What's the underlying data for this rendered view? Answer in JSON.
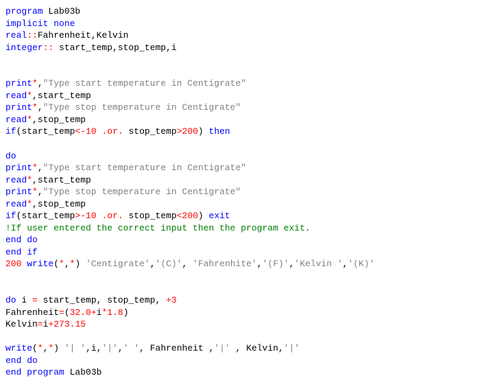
{
  "lines": [
    [
      [
        "kw",
        "program"
      ],
      [
        "txt",
        " Lab03b"
      ]
    ],
    [
      [
        "kw",
        "implicit none"
      ]
    ],
    [
      [
        "kw",
        "real"
      ],
      [
        "op",
        "::"
      ],
      [
        "txt",
        "Fahrenheit,Kelvin"
      ]
    ],
    [
      [
        "kw",
        "integer"
      ],
      [
        "op",
        ":: "
      ],
      [
        "txt",
        "start_temp,stop_temp,i"
      ]
    ],
    [],
    [],
    [
      [
        "kw",
        "print"
      ],
      [
        "op",
        "*"
      ],
      [
        "txt",
        ","
      ],
      [
        "str",
        "\"Type start temperature in Centigrate\""
      ]
    ],
    [
      [
        "kw",
        "read"
      ],
      [
        "op",
        "*"
      ],
      [
        "txt",
        ",start_temp"
      ]
    ],
    [
      [
        "kw",
        "print"
      ],
      [
        "op",
        "*"
      ],
      [
        "txt",
        ","
      ],
      [
        "str",
        "\"Type stop temperature in Centigrate\""
      ]
    ],
    [
      [
        "kw",
        "read"
      ],
      [
        "op",
        "*"
      ],
      [
        "txt",
        ",stop_temp"
      ]
    ],
    [
      [
        "kw",
        "if"
      ],
      [
        "txt",
        "(start_temp"
      ],
      [
        "op",
        "<-"
      ],
      [
        "num",
        "10"
      ],
      [
        "txt",
        " "
      ],
      [
        "op",
        ".or."
      ],
      [
        "txt",
        " stop_temp"
      ],
      [
        "op",
        ">"
      ],
      [
        "num",
        "200"
      ],
      [
        "txt",
        ") "
      ],
      [
        "kw",
        "then"
      ]
    ],
    [],
    [
      [
        "kw",
        "do"
      ]
    ],
    [
      [
        "kw",
        "print"
      ],
      [
        "op",
        "*"
      ],
      [
        "txt",
        ","
      ],
      [
        "str",
        "\"Type start temperature in Centigrate\""
      ]
    ],
    [
      [
        "kw",
        "read"
      ],
      [
        "op",
        "*"
      ],
      [
        "txt",
        ",start_temp"
      ]
    ],
    [
      [
        "kw",
        "print"
      ],
      [
        "op",
        "*"
      ],
      [
        "txt",
        ","
      ],
      [
        "str",
        "\"Type stop temperature in Centigrate\""
      ]
    ],
    [
      [
        "kw",
        "read"
      ],
      [
        "op",
        "*"
      ],
      [
        "txt",
        ",stop_temp"
      ]
    ],
    [
      [
        "kw",
        "if"
      ],
      [
        "txt",
        "(start_temp"
      ],
      [
        "op",
        ">-"
      ],
      [
        "num",
        "10"
      ],
      [
        "txt",
        " "
      ],
      [
        "op",
        ".or."
      ],
      [
        "txt",
        " stop_temp"
      ],
      [
        "op",
        "<"
      ],
      [
        "num",
        "200"
      ],
      [
        "txt",
        ") "
      ],
      [
        "kw",
        "exit"
      ]
    ],
    [
      [
        "cm",
        "!If user entered the correct input then the program exit."
      ]
    ],
    [
      [
        "kw",
        "end do"
      ]
    ],
    [
      [
        "kw",
        "end if"
      ]
    ],
    [
      [
        "num",
        "200"
      ],
      [
        "txt",
        " "
      ],
      [
        "kw",
        "write"
      ],
      [
        "txt",
        "("
      ],
      [
        "op",
        "*"
      ],
      [
        "txt",
        ","
      ],
      [
        "op",
        "*"
      ],
      [
        "txt",
        ") "
      ],
      [
        "str",
        "'Centigrate'"
      ],
      [
        "txt",
        ","
      ],
      [
        "str",
        "'(C)'"
      ],
      [
        "txt",
        ", "
      ],
      [
        "str",
        "'Fahrenhite'"
      ],
      [
        "txt",
        ","
      ],
      [
        "str",
        "'(F)'"
      ],
      [
        "txt",
        ","
      ],
      [
        "str",
        "'Kelvin '"
      ],
      [
        "txt",
        ","
      ],
      [
        "str",
        "'(K)'"
      ]
    ],
    [],
    [],
    [
      [
        "kw",
        "do"
      ],
      [
        "txt",
        " i "
      ],
      [
        "op",
        "="
      ],
      [
        "txt",
        " start_temp, stop_temp, "
      ],
      [
        "op",
        "+"
      ],
      [
        "num",
        "3"
      ]
    ],
    [
      [
        "txt",
        "Fahrenheit"
      ],
      [
        "op",
        "="
      ],
      [
        "txt",
        "("
      ],
      [
        "num",
        "32.0"
      ],
      [
        "op",
        "+"
      ],
      [
        "txt",
        "i"
      ],
      [
        "op",
        "*"
      ],
      [
        "num",
        "1.8"
      ],
      [
        "txt",
        ")"
      ]
    ],
    [
      [
        "txt",
        "Kelvin"
      ],
      [
        "op",
        "="
      ],
      [
        "txt",
        "i"
      ],
      [
        "op",
        "+"
      ],
      [
        "num",
        "273.15"
      ]
    ],
    [],
    [
      [
        "kw",
        "write"
      ],
      [
        "txt",
        "("
      ],
      [
        "op",
        "*"
      ],
      [
        "txt",
        ","
      ],
      [
        "op",
        "*"
      ],
      [
        "txt",
        ") "
      ],
      [
        "str",
        "'| '"
      ],
      [
        "txt",
        ",i,"
      ],
      [
        "str",
        "'|'"
      ],
      [
        "txt",
        ","
      ],
      [
        "str",
        "' '"
      ],
      [
        "txt",
        ", Fahrenheit ,"
      ],
      [
        "str",
        "'|'"
      ],
      [
        "txt",
        " , Kelvin,"
      ],
      [
        "str",
        "'|'"
      ]
    ],
    [
      [
        "kw",
        "end do"
      ]
    ],
    [
      [
        "kw",
        "end program"
      ],
      [
        "txt",
        " Lab03b"
      ]
    ]
  ]
}
